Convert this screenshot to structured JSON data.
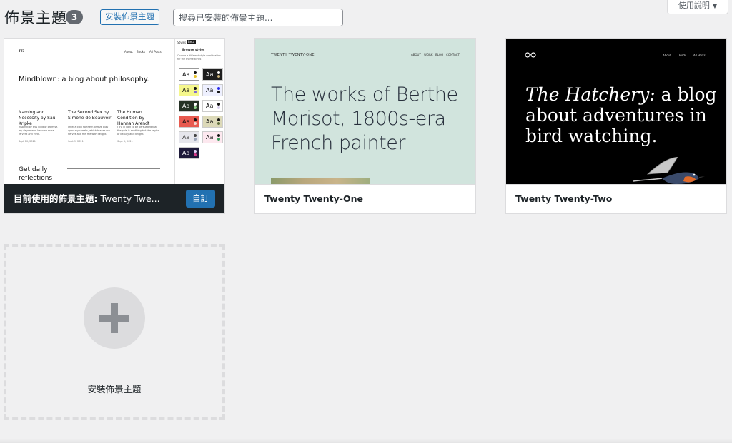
{
  "header": {
    "title": "佈景主題",
    "count": "3",
    "add_button": "安裝佈景主題",
    "search_placeholder": "搜尋已安裝的佈景主題...",
    "help_tab": "使用說明"
  },
  "themes": [
    {
      "name": "Twenty Twe...",
      "active_prefix": "目前使用的佈景主題:",
      "customize_label": "自訂",
      "preview": {
        "site_title": "TT3",
        "nav": [
          "About",
          "Books",
          "All Posts"
        ],
        "hero": "Mindblown: a blog about philosophy.",
        "posts": [
          {
            "title": "Naming and Necessity by Saul Kripke",
            "excerpt": "Inspired by this wind of promise, my daydreams become more fervent and vivid.",
            "date": "Sept 10, 2021"
          },
          {
            "title": "The Second Sex by Simone de Beauvoir",
            "excerpt": "I feel a cold northern breeze play upon my cheeks, which braces my nerves and fills me with delight.",
            "date": "Sept 9, 2021"
          },
          {
            "title": "The Human Condition by Hannah Arendt",
            "excerpt": "I try in vain to be persuaded that the pole is anything but the region of beauty and delight.",
            "date": "Sept 8, 2021"
          }
        ],
        "footer_heading": "Get daily reflections",
        "styles_panel": {
          "tab1": "Styles",
          "tab2": "Beta",
          "heading": "Browse styles",
          "desc": "Choose a different style combination for the theme styles",
          "swatch_label": "Aa"
        }
      }
    },
    {
      "name": "Twenty Twenty-One",
      "preview": {
        "site_title": "TWENTY TWENTY-ONE",
        "nav": [
          "ABOUT",
          "WORK",
          "BLOG",
          "CONTACT"
        ],
        "hero": "The works of Berthe Morisot, 1800s-era French painter"
      }
    },
    {
      "name": "Twenty Twenty-Two",
      "preview": {
        "nav": [
          "About",
          "Birds",
          "All Posts"
        ],
        "hero_italic": "The Hatchery:",
        "hero_rest": " a blog about adventures in bird watching."
      }
    }
  ],
  "add_new": {
    "label": "安裝佈景主題"
  },
  "colors": {
    "accent": "#2271b1",
    "active_bar": "#1d2327",
    "tt1_bg": "#d1e4dd",
    "tt2_bg": "#000000"
  }
}
